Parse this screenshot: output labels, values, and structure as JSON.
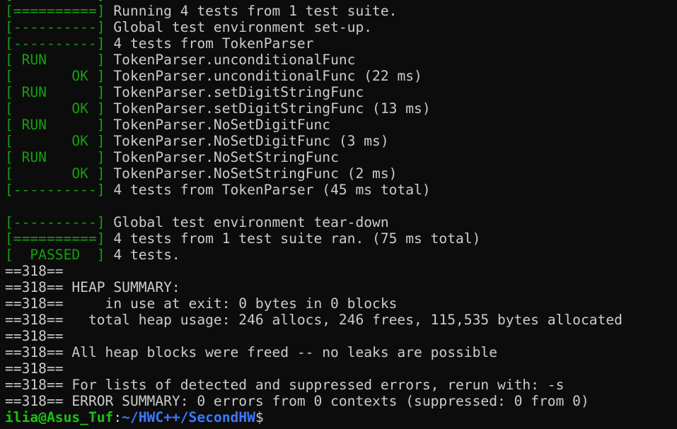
{
  "terminal": {
    "clipped_top_line": "[==========] ",
    "lines": [
      {
        "tag": "[==========]",
        "text": " Running 4 tests from 1 test suite."
      },
      {
        "tag": "[----------]",
        "text": " Global test environment set-up."
      },
      {
        "tag": "[----------]",
        "text": " 4 tests from TokenParser"
      },
      {
        "tag": "[ RUN      ]",
        "text": " TokenParser.unconditionalFunc"
      },
      {
        "tag": "[       OK ]",
        "text": " TokenParser.unconditionalFunc (22 ms)"
      },
      {
        "tag": "[ RUN      ]",
        "text": " TokenParser.setDigitStringFunc"
      },
      {
        "tag": "[       OK ]",
        "text": " TokenParser.setDigitStringFunc (13 ms)"
      },
      {
        "tag": "[ RUN      ]",
        "text": " TokenParser.NoSetDigitFunc"
      },
      {
        "tag": "[       OK ]",
        "text": " TokenParser.NoSetDigitFunc (3 ms)"
      },
      {
        "tag": "[ RUN      ]",
        "text": " TokenParser.NoSetStringFunc"
      },
      {
        "tag": "[       OK ]",
        "text": " TokenParser.NoSetStringFunc (2 ms)"
      },
      {
        "tag": "[----------]",
        "text": " 4 tests from TokenParser (45 ms total)"
      },
      {
        "tag": "",
        "text": ""
      },
      {
        "tag": "[----------]",
        "text": " Global test environment tear-down"
      },
      {
        "tag": "[==========]",
        "text": " 4 tests from 1 test suite ran. (75 ms total)"
      },
      {
        "tag": "[  PASSED  ]",
        "text": " 4 tests."
      },
      {
        "tag": "",
        "text": "==318=="
      },
      {
        "tag": "",
        "text": "==318== HEAP SUMMARY:"
      },
      {
        "tag": "",
        "text": "==318==     in use at exit: 0 bytes in 0 blocks"
      },
      {
        "tag": "",
        "text": "==318==   total heap usage: 246 allocs, 246 frees, 115,535 bytes allocated"
      },
      {
        "tag": "",
        "text": "==318=="
      },
      {
        "tag": "",
        "text": "==318== All heap blocks were freed -- no leaks are possible"
      },
      {
        "tag": "",
        "text": "==318=="
      },
      {
        "tag": "",
        "text": "==318== For lists of detected and suppressed errors, rerun with: -s"
      },
      {
        "tag": "",
        "text": "==318== ERROR SUMMARY: 0 errors from 0 contexts (suppressed: 0 from 0)"
      }
    ],
    "prompt": {
      "user_host": "ilia@Asus_Tuf",
      "separator": ":",
      "path": "~/HWC++/SecondHW",
      "symbol": "$"
    }
  },
  "colors": {
    "background": "#0c0c0c",
    "text": "#cccccc",
    "tag_green": "#13a10e",
    "prompt_user": "#16c60c",
    "prompt_path": "#3b78ff"
  }
}
